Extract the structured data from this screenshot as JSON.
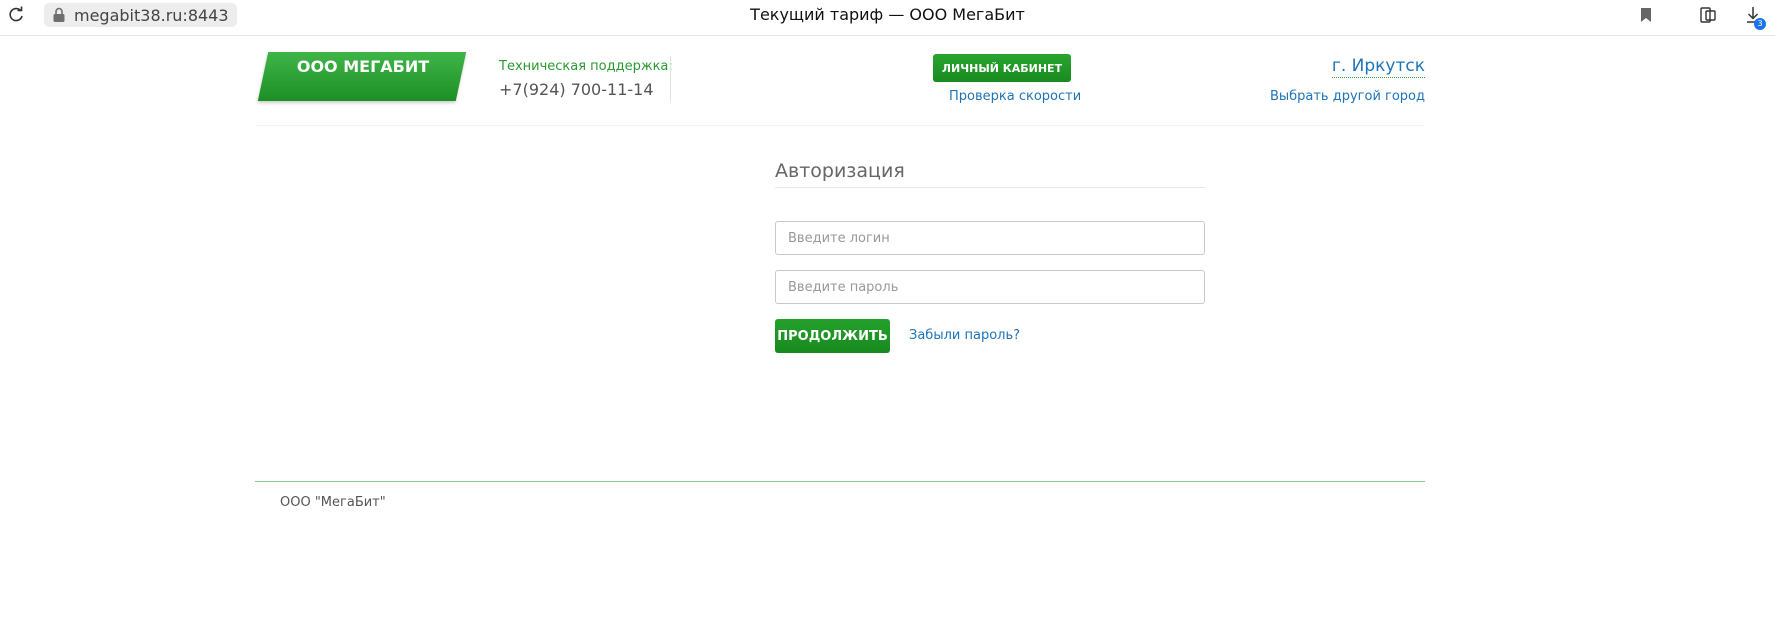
{
  "browser": {
    "url": "megabit38.ru:8443",
    "page_title": "Текущий тариф — ООО МегаБит",
    "download_count": "3"
  },
  "header": {
    "logo_text": "ООО МЕГАБИТ",
    "support_label": "Техническая поддержка:",
    "support_phone": "+7(924) 700-11-14",
    "cabinet_button": "ЛИЧНЫЙ КАБИНЕТ",
    "speed_link": "Проверка скорости",
    "city": "г. Иркутск",
    "change_city": "Выбрать другой город"
  },
  "auth": {
    "title": "Авторизация",
    "login_placeholder": "Введите логин",
    "password_placeholder": "Введите пароль",
    "continue_button": "ПРОДОЛЖИТЬ",
    "forgot_link": "Забыли пароль?"
  },
  "footer": {
    "text": "ООО \"МегаБит\""
  },
  "colors": {
    "brand_green": "#1d8f24",
    "link_blue": "#1f74b8"
  }
}
